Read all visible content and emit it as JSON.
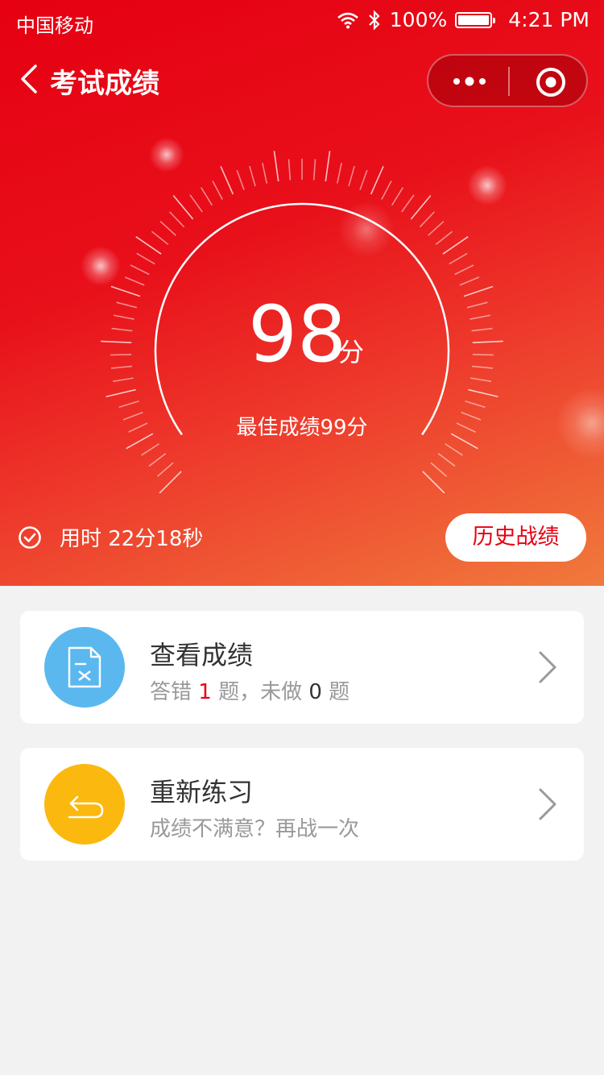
{
  "status_bar": {
    "carrier": "中国移动",
    "battery": "100%",
    "time": "4:21 PM"
  },
  "nav": {
    "title": "考试成绩",
    "back_icon": "chevron-left-icon",
    "more_icon": "more-dots-icon",
    "close_icon": "target-icon"
  },
  "result": {
    "score": "98",
    "unit": "分",
    "best_label": "最佳成绩99分",
    "score_value": 98,
    "max_score": 100
  },
  "time": {
    "label": "用时 22分18秒"
  },
  "history_button": {
    "label": "历史战绩"
  },
  "cards": [
    {
      "title": "查看成绩",
      "sub_prefix": "答错 ",
      "wrong_count": "1",
      "sub_middle": " 题，未做 ",
      "undone_count": "0",
      "sub_suffix": " 题",
      "icon": "document-x-icon",
      "icon_color": "#5bb8ef"
    },
    {
      "title": "重新练习",
      "subtitle": "成绩不满意？再战一次",
      "icon": "undo-arrow-icon",
      "icon_color": "#fbb80e"
    }
  ],
  "colors": {
    "brand_red": "#e60012",
    "orange": "#f07a3c",
    "background": "#f2f2f2"
  }
}
